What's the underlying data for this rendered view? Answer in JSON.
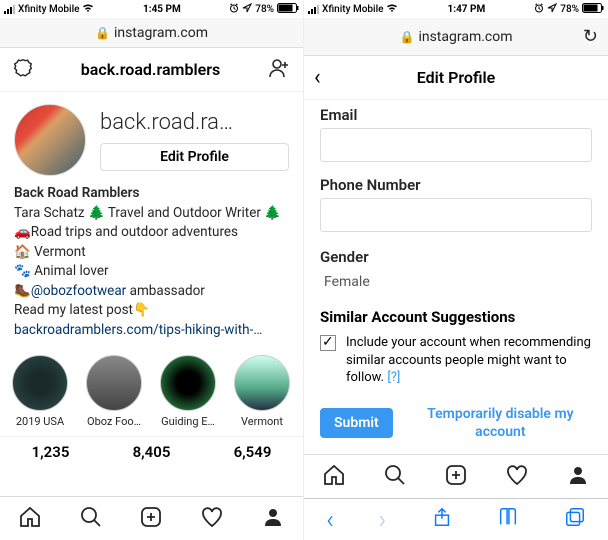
{
  "left": {
    "status": {
      "carrier": "Xfinity Mobile",
      "time": "1:45 PM",
      "battery": "78%"
    },
    "url": "instagram.com",
    "header": {
      "username": "back.road.ramblers"
    },
    "profile": {
      "username_display": "back.road.ra…",
      "edit_btn": "Edit Profile",
      "name": "Back Road Ramblers",
      "line1": "Tara Schatz 🌲 Travel and Outdoor Writer 🌲",
      "line2": "🚗Road trips and outdoor adventures",
      "line3": "🏠 Vermont",
      "line4": "🐾 Animal lover",
      "line5_pre": "🥾",
      "line5_mention": "@obozfootwear",
      "line5_post": " ambassador",
      "line6": "Read my latest post👇",
      "link": "backroadramblers.com/tips-hiking-with-…"
    },
    "highlights": [
      {
        "label": "2019 USA"
      },
      {
        "label": "Oboz Foo…"
      },
      {
        "label": "Guiding E…"
      },
      {
        "label": "Vermont"
      }
    ],
    "stats": {
      "posts": "1,235",
      "followers": "8,405",
      "following": "6,549"
    }
  },
  "right": {
    "status": {
      "carrier": "Xfinity Mobile",
      "time": "1:47 PM",
      "battery": "78%"
    },
    "url": "instagram.com",
    "header": {
      "title": "Edit Profile"
    },
    "labels": {
      "email": "Email",
      "phone": "Phone Number",
      "gender": "Gender"
    },
    "gender_value": "Female",
    "sas": {
      "title": "Similar Account Suggestions",
      "desc": "Include your account when recommending similar accounts people might want to follow.  ",
      "qm": "[?]"
    },
    "buttons": {
      "submit": "Submit",
      "disable": "Temporarily disable my account"
    }
  }
}
